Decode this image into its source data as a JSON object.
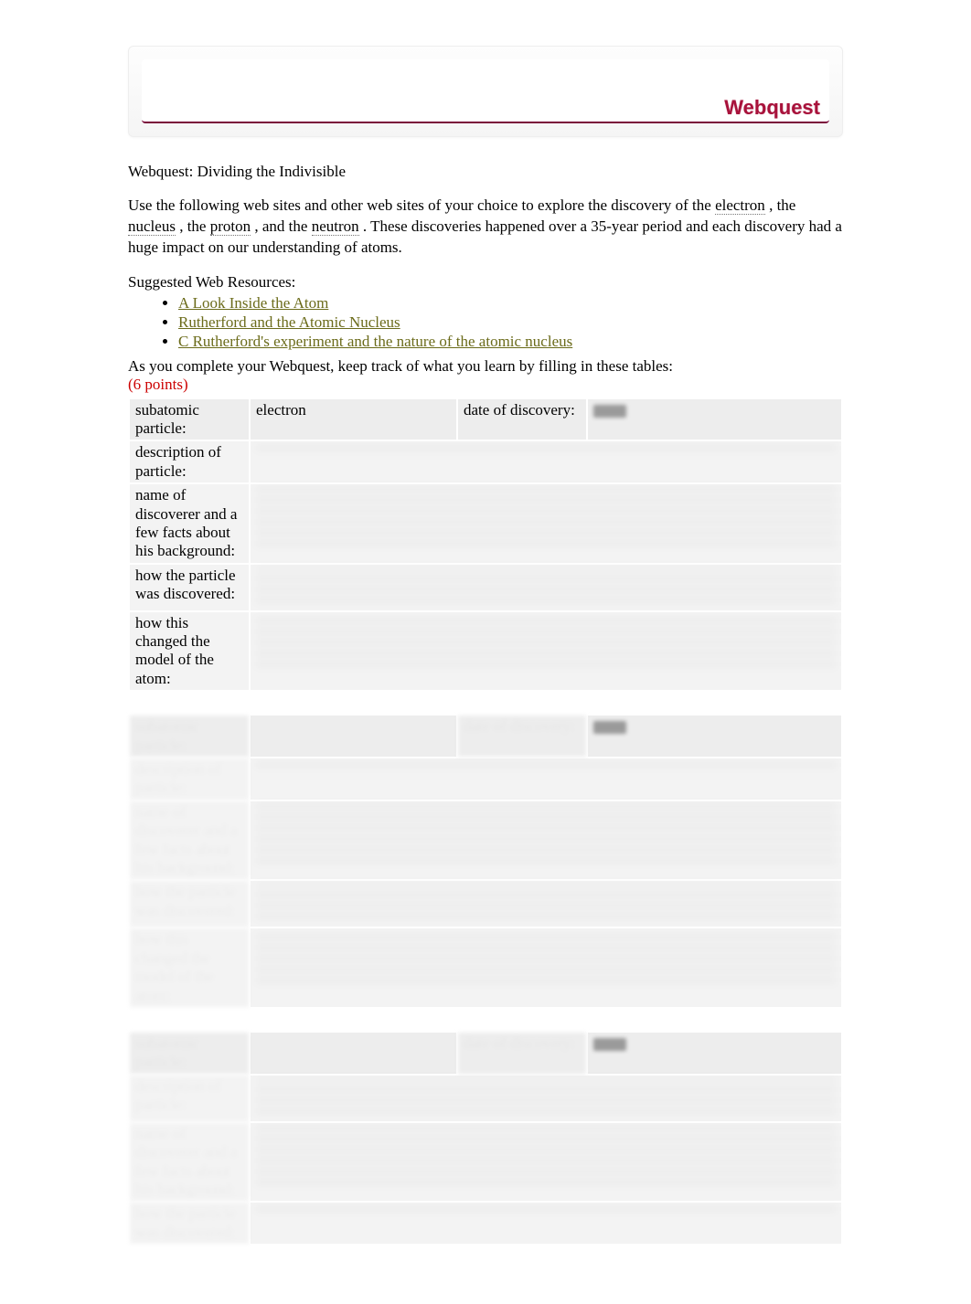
{
  "banner": {
    "title": "Webquest"
  },
  "intro": {
    "title": "Webquest: Dividing the Indivisible",
    "lead_a": "Use the following web sites and other web sites of your choice to explore the discovery of the ",
    "term1": "electron",
    "sep1": ", the ",
    "term2": "nucleus",
    "sep2": ", the ",
    "term3": "proton",
    "sep3": ", and the ",
    "term4": "neutron",
    "lead_b": ". These discoveries happened over a 35-year period and each discovery had a huge impact on our understanding of atoms."
  },
  "resources": {
    "heading": "Suggested Web Resources:",
    "items": [
      {
        "label": "A Look Inside the Atom"
      },
      {
        "label": "Rutherford and the Atomic Nucleus"
      },
      {
        "label": "C Rutherford's experiment and the nature of the atomic nucleus"
      }
    ]
  },
  "instructions": {
    "text": "As you complete your Webquest, keep track of what you learn by filling in these tables:",
    "points": "(6 points)"
  },
  "row_labels": {
    "particle": "subatomic particle:",
    "date": "date of discovery:",
    "desc": "description of particle:",
    "discoverer": "name of discoverer and a few facts about his background:",
    "howdisc": "how the particle was discovered:",
    "howchanged": "how this changed the model of the atom:"
  },
  "table1": {
    "particle_value": "electron"
  }
}
